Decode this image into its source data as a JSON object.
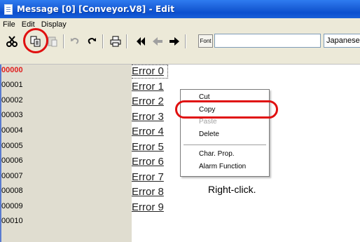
{
  "window": {
    "title": "Message [0] [Conveyor.V8] - Edit"
  },
  "menubar": {
    "items": [
      "File",
      "Edit",
      "Display"
    ]
  },
  "toolbar": {
    "icons": [
      "cut-icon",
      "copy-icon",
      "paste-icon",
      "undo-icon",
      "redo-icon",
      "print-icon",
      "first-icon",
      "previous-icon",
      "next-icon"
    ],
    "font_label": "Font",
    "font_value": "",
    "language": "Japanese"
  },
  "line_numbers": [
    "00000",
    "00001",
    "00002",
    "00003",
    "00004",
    "00005",
    "00006",
    "00007",
    "00008",
    "00009",
    "00010"
  ],
  "messages": [
    "Error 0",
    "Error 1",
    "Error 2",
    "Error 3",
    "Error 4",
    "Error 5",
    "Error 6",
    "Error 7",
    "Error 8",
    "Error 9"
  ],
  "context_menu": {
    "items": [
      "Cut",
      "Copy",
      "Paste",
      "Delete",
      "Char. Prop.",
      "Alarm Function"
    ],
    "disabled": [
      "Paste"
    ]
  },
  "annotation": {
    "hint": "Right-click."
  },
  "colors": {
    "highlight": "#e01010",
    "active_line": "#e02020"
  }
}
